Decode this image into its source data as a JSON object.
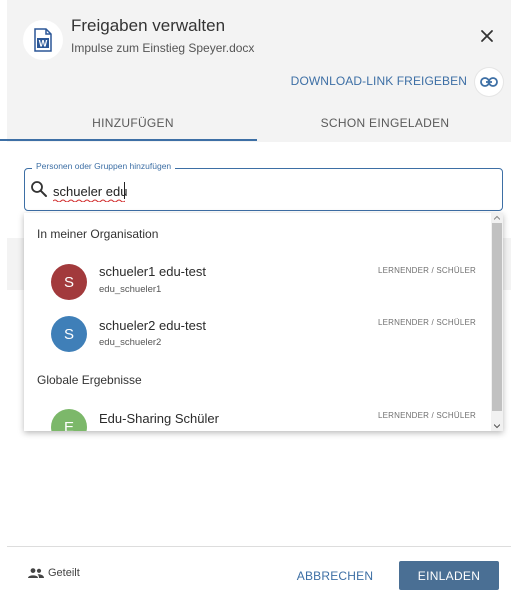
{
  "dialog": {
    "title": "Freigaben verwalten",
    "filename": "Impulse zum Einstieg Speyer.docx",
    "file_icon_letter": "W",
    "download_link_label": "DOWNLOAD-LINK FREIGEBEN"
  },
  "tabs": [
    {
      "label": "HINZUFÜGEN",
      "active": true
    },
    {
      "label": "SCHON EINGELADEN",
      "active": false
    }
  ],
  "search": {
    "legend": "Personen oder Gruppen hinzufügen",
    "value": "schueler edu"
  },
  "dropdown": {
    "groups": [
      {
        "label": "In meiner Organisation",
        "options": [
          {
            "initial": "S",
            "name": "schueler1 edu-test",
            "username": "edu_schueler1",
            "role": "LERNENDER / SCHÜLER",
            "color": "#a23a3c"
          },
          {
            "initial": "S",
            "name": "schueler2 edu-test",
            "username": "edu_schueler2",
            "role": "LERNENDER / SCHÜLER",
            "color": "#3f7fb8"
          }
        ]
      },
      {
        "label": "Globale Ergebnisse",
        "options": [
          {
            "initial": "E",
            "name": "Edu-Sharing Schüler",
            "role": "LERNENDER / SCHÜLER",
            "color": "#7cb86a"
          }
        ]
      }
    ]
  },
  "footer": {
    "shared_label": "Geteilt",
    "cancel_label": "ABBRECHEN",
    "invite_label": "EINLADEN"
  },
  "colors": {
    "accent": "#3d6fa5",
    "primary_button": "#4a6f94",
    "header_bg": "#f3f3f3"
  }
}
